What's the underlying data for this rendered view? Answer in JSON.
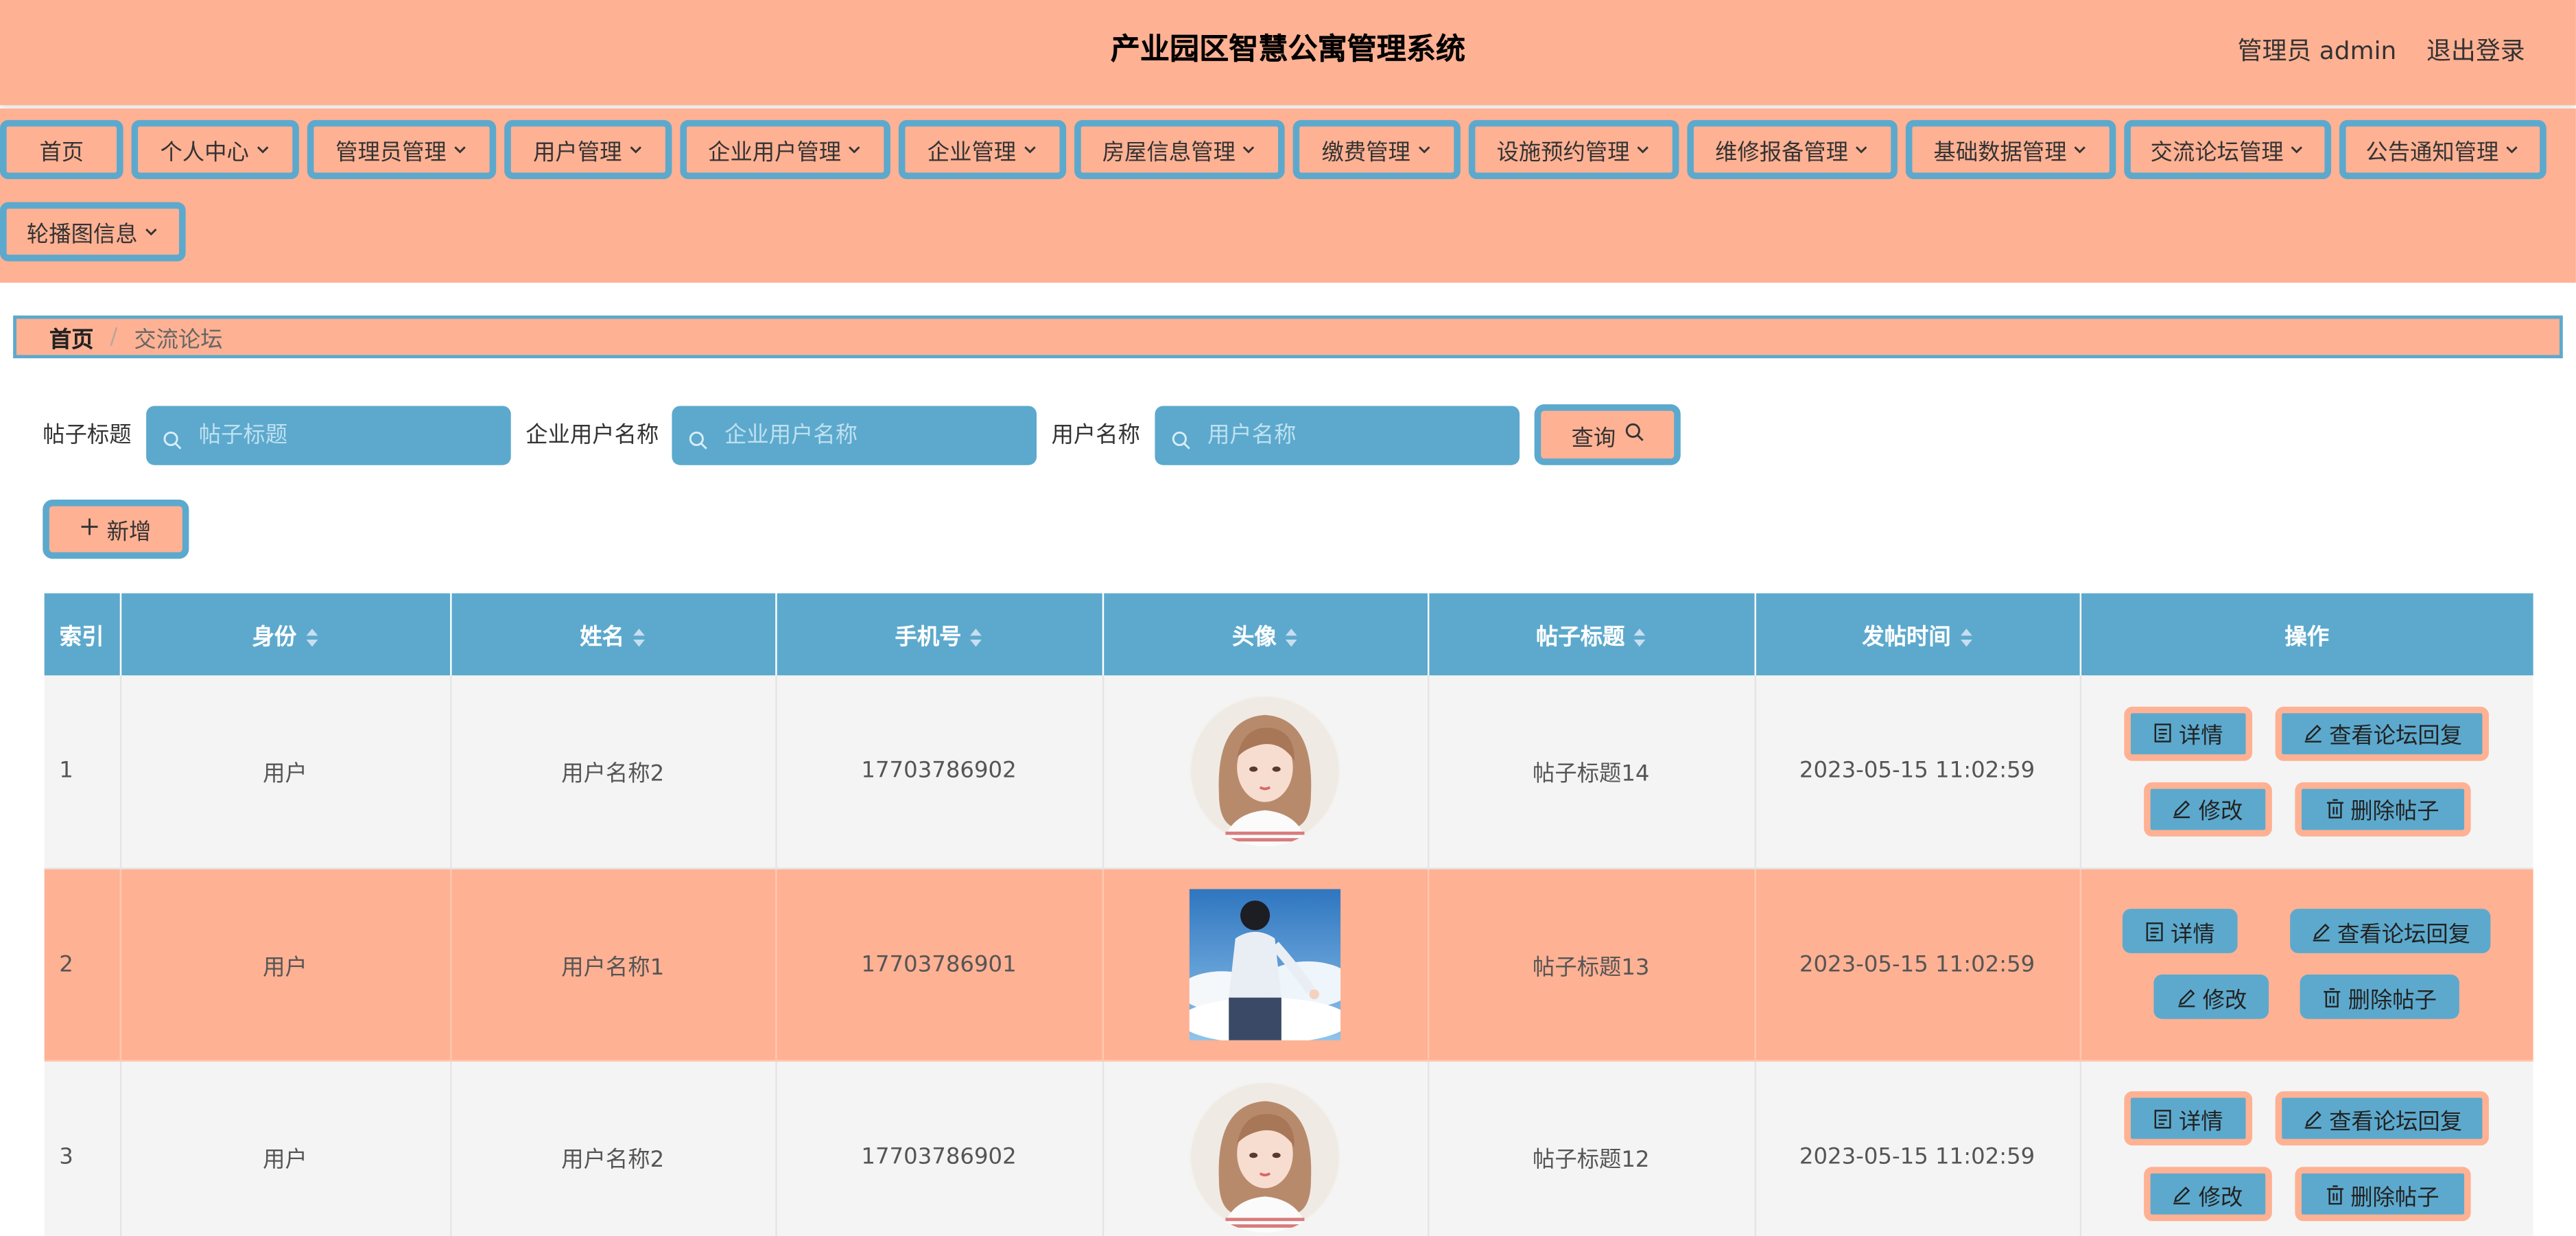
{
  "header": {
    "title": "产业园区智慧公寓管理系统",
    "admin": "管理员 admin",
    "logout": "退出登录"
  },
  "nav": [
    {
      "label": "首页",
      "dropdown": false
    },
    {
      "label": "个人中心",
      "dropdown": true
    },
    {
      "label": "管理员管理",
      "dropdown": true
    },
    {
      "label": "用户管理",
      "dropdown": true
    },
    {
      "label": "企业用户管理",
      "dropdown": true
    },
    {
      "label": "企业管理",
      "dropdown": true
    },
    {
      "label": "房屋信息管理",
      "dropdown": true
    },
    {
      "label": "缴费管理",
      "dropdown": true
    },
    {
      "label": "设施预约管理",
      "dropdown": true
    },
    {
      "label": "维修报备管理",
      "dropdown": true
    },
    {
      "label": "基础数据管理",
      "dropdown": true
    },
    {
      "label": "交流论坛管理",
      "dropdown": true
    },
    {
      "label": "公告通知管理",
      "dropdown": true
    },
    {
      "label": "轮播图信息",
      "dropdown": true
    }
  ],
  "breadcrumb": {
    "home": "首页",
    "sep": "/",
    "current": "交流论坛"
  },
  "search": {
    "fields": [
      {
        "label": "帖子标题",
        "placeholder": "帖子标题",
        "value": ""
      },
      {
        "label": "企业用户名称",
        "placeholder": "企业用户名称",
        "value": ""
      },
      {
        "label": "用户名称",
        "placeholder": "用户名称",
        "value": ""
      }
    ],
    "query_label": "查询",
    "add_label": "新增"
  },
  "table": {
    "columns": [
      "索引",
      "身份",
      "姓名",
      "手机号",
      "头像",
      "帖子标题",
      "发帖时间",
      "操作"
    ],
    "sortable": [
      false,
      true,
      true,
      true,
      true,
      true,
      true,
      false
    ],
    "rows": [
      {
        "index": "1",
        "identity": "用户",
        "name": "用户名称2",
        "phone": "17703786902",
        "avatar": "girl-avatar",
        "title": "帖子标题14",
        "time": "2023-05-15 11:02:59"
      },
      {
        "index": "2",
        "identity": "用户",
        "name": "用户名称1",
        "phone": "17703786901",
        "avatar": "boy-sky-avatar",
        "title": "帖子标题13",
        "time": "2023-05-15 11:02:59"
      },
      {
        "index": "3",
        "identity": "用户",
        "name": "用户名称2",
        "phone": "17703786902",
        "avatar": "girl-avatar",
        "title": "帖子标题12",
        "time": "2023-05-15 11:02:59"
      }
    ],
    "actions": {
      "detail": "详情",
      "view_reply": "查看论坛回复",
      "edit": "修改",
      "delete": "删除帖子"
    }
  },
  "colors": {
    "accent": "#5ca9cd",
    "salmon": "#ffb193"
  }
}
